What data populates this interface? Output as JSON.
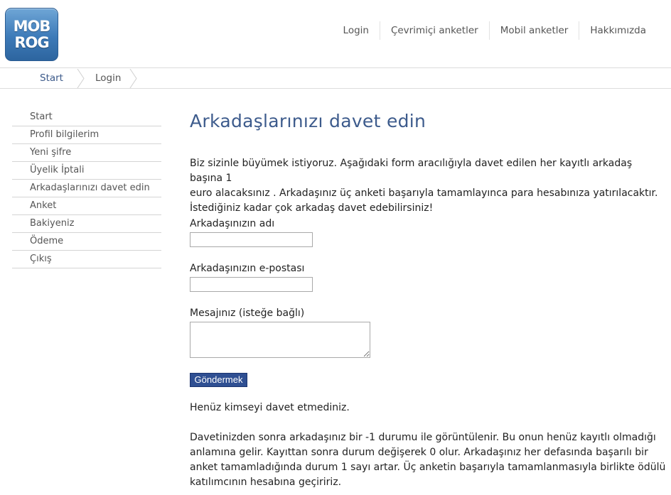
{
  "logo": {
    "line1": "MOB",
    "line2": "ROG"
  },
  "topnav": [
    {
      "label": "Login"
    },
    {
      "label": "Çevrimiçi anketler"
    },
    {
      "label": "Mobil anketler"
    },
    {
      "label": "Hakkımızda"
    }
  ],
  "breadcrumb": [
    {
      "label": "Start"
    },
    {
      "label": "Login"
    }
  ],
  "sidebar": [
    {
      "label": "Start"
    },
    {
      "label": "Profil bilgilerim"
    },
    {
      "label": "Yeni şifre"
    },
    {
      "label": "Üyelik İptali"
    },
    {
      "label": "Arkadaşlarınızı davet edin"
    },
    {
      "label": "Anket"
    },
    {
      "label": "Bakiyeniz"
    },
    {
      "label": "Ödeme"
    },
    {
      "label": "Çıkış"
    }
  ],
  "main": {
    "title": "Arkadaşlarınızı davet edin",
    "intro_lines": [
      "Biz sizinle büyümek istiyoruz. Aşağıdaki form aracılığıyla davet edilen her kayıtlı arkadaş başına 1",
      "euro alacaksınız . Arkadaşınız üç anketi başarıyla tamamlayınca para hesabınıza yatırılacaktır.",
      "İstediğiniz kadar çok arkadaş davet edebilirsiniz!"
    ],
    "form": {
      "name_label": "Arkadaşınızın adı",
      "name_value": "",
      "email_label": "Arkadaşınızın e-postası",
      "email_value": "",
      "message_label": "Mesajınız (isteğe bağlı)",
      "message_value": "",
      "submit_label": "Göndermek"
    },
    "status_text": "Henüz kimseyi davet etmediniz.",
    "info_lines": [
      "Davetinizden sonra arkadaşınız bir -1 durumu ile görüntülenir. Bu onun henüz kayıtlı olmadığı",
      "anlamına gelir. Kayıttan sonra durum değişerek 0 olur. Arkadaşınız her defasında başarılı bir",
      "anket tamamladığında durum 1 sayı artar. Üç anketin başarıyla tamamlanmasıyla birlikte ödülü",
      "katılımcının hesabına geçiririz."
    ]
  },
  "colors": {
    "accent": "#3d5b8c",
    "button": "#2f4f92",
    "divider": "#d4d4d4"
  }
}
